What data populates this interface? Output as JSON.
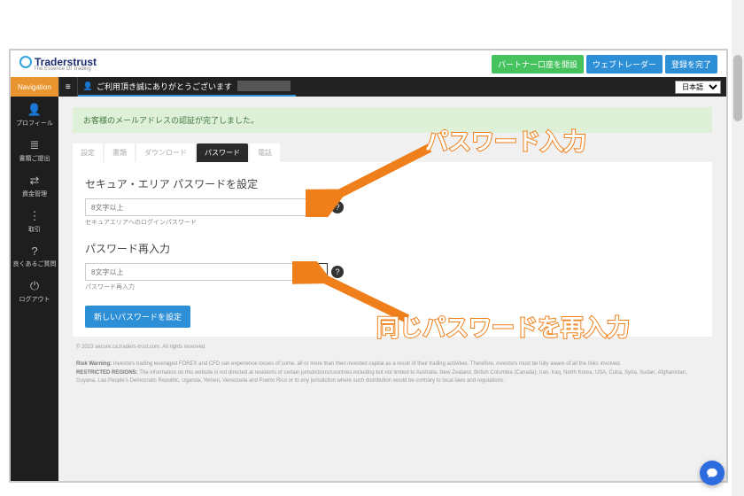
{
  "logo": {
    "brand": "Traderstrust",
    "tag": "The Essence Of Trading"
  },
  "header_buttons": {
    "partner": "パートナー口座を開設",
    "webtrader": "ウェブトレーダー",
    "complete": "登録を完了"
  },
  "topbar": {
    "nav": "Navigation",
    "greeting": "ご利用頂き誠にありがとうございます",
    "lang": "日本語"
  },
  "sidebar": {
    "items": [
      {
        "icon": "👤",
        "label": "プロフィール"
      },
      {
        "icon": "≣",
        "label": "書類ご提出"
      },
      {
        "icon": "⇄",
        "label": "資金管理"
      },
      {
        "icon": "⋮",
        "label": "取引"
      },
      {
        "icon": "?",
        "label": "良くあるご質問"
      },
      {
        "icon": "⏻",
        "label": "ログアウト"
      }
    ]
  },
  "alert": "お客様のメールアドレスの認証が完了しました。",
  "tabs": [
    "設定",
    "書類",
    "ダウンロード",
    "パスワード",
    "電話"
  ],
  "active_tab": "パスワード",
  "section1": {
    "title": "セキュア・エリア パスワードを設定",
    "placeholder": "8文字以上",
    "hint": "セキュアエリアへのログインパスワード"
  },
  "section2": {
    "title": "パスワード再入力",
    "placeholder": "8文字以上",
    "hint": "パスワード再入力"
  },
  "save": "新しいパスワードを設定",
  "footer": {
    "copy": "© 2023 secure.ca.traders-trust.com. All rights reserved.",
    "risk_h": "Risk Warning:",
    "risk": " Investors trading leveraged FOREX and CFD can experience losses of some, all or more than their invested capital as a result of their trading activities. Therefore, investors must be fully aware of all the risks involved.",
    "reg_h": "RESTRICTED REGIONS:",
    "reg": " The information on this website is not directed at residents of certain jurisdictions/countries including but not limited to Australia, New Zealand, British Columbia (Canada), Iran, Iraq, North Korea, USA, Cuba, Syria, Sudan, Afghanistan, Guyana, Lao People's Democratic Republic, Uganda, Yemen, Venezuela and Puerto Rico or to any jurisdiction where such distribution would be contrary to local laws and regulations."
  },
  "anno": {
    "a1": "パスワード入力",
    "a2": "同じパスワードを再入力"
  }
}
